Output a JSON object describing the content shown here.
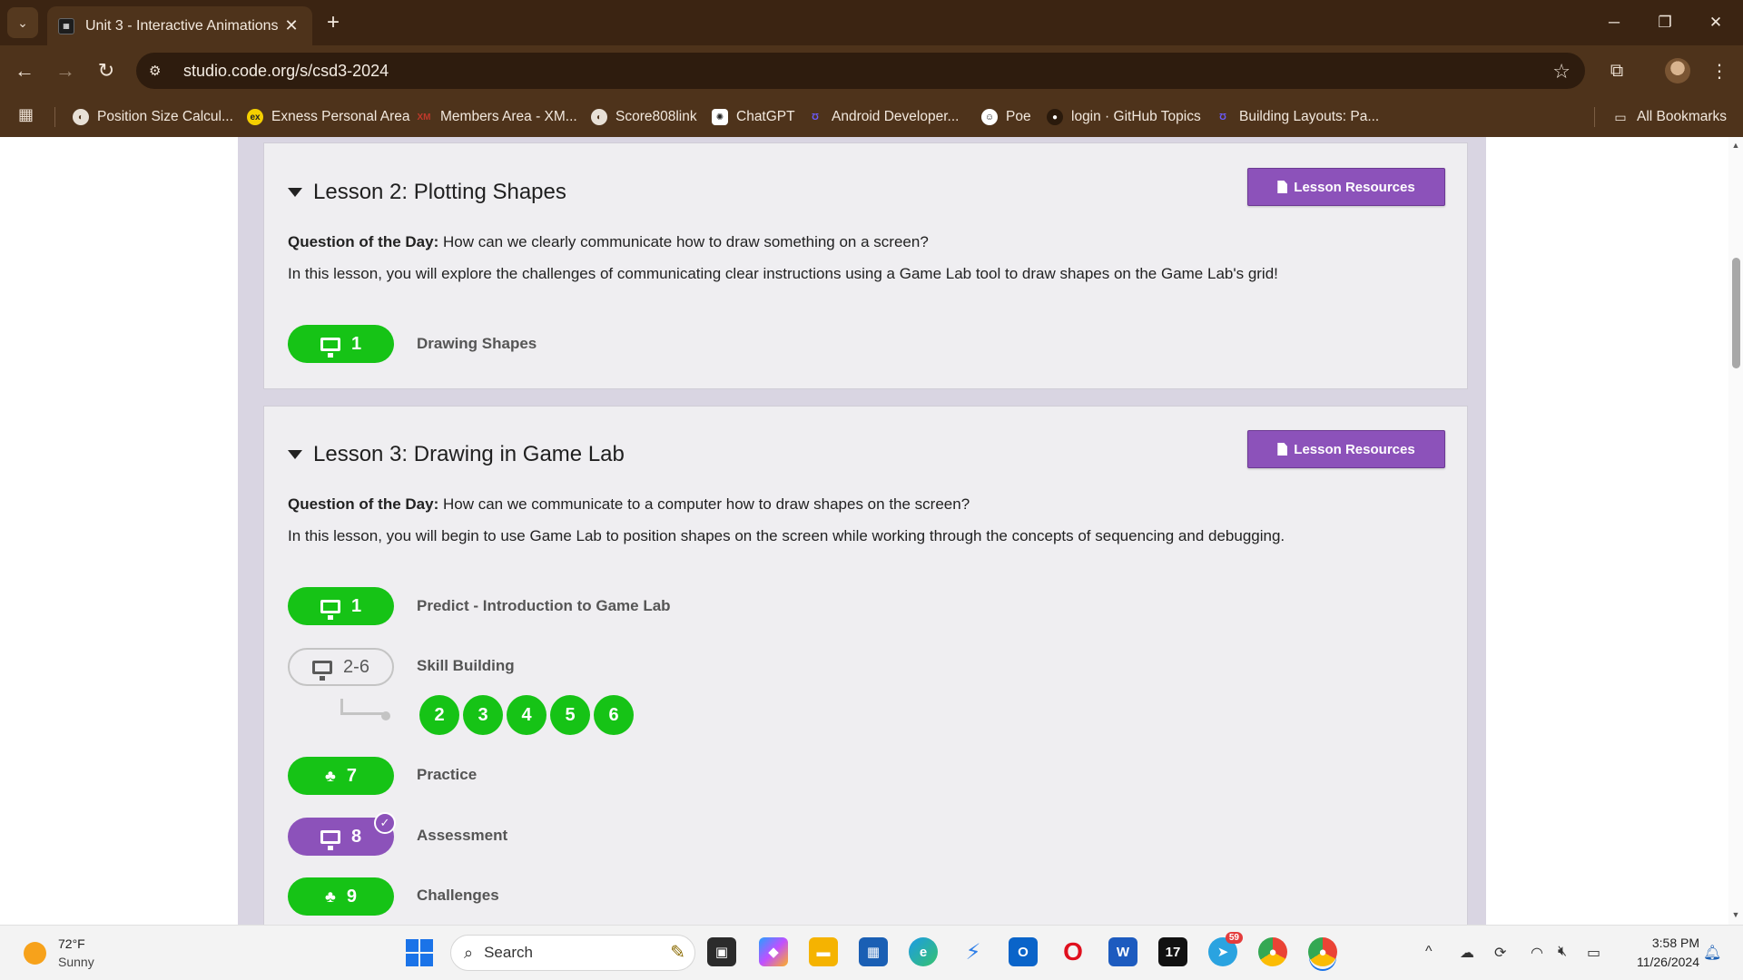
{
  "browser": {
    "tab_title": "Unit 3 - Interactive Animations",
    "tab_close": "✕",
    "new_tab": "+",
    "url": "studio.code.org/s/csd3-2024",
    "bookmarks": [
      {
        "label": "Position Size Calcul...",
        "icon": "globe-icon"
      },
      {
        "label": "Exness Personal Area",
        "icon": "exness-icon"
      },
      {
        "label": "Members Area - XM...",
        "icon": "xm-icon"
      },
      {
        "label": "Score808link",
        "icon": "globe-icon"
      },
      {
        "label": "ChatGPT",
        "icon": "chatgpt-icon"
      },
      {
        "label": "Android Developer...",
        "icon": "udemy-icon"
      },
      {
        "label": "Poe",
        "icon": "poe-icon"
      },
      {
        "label": "login · GitHub Topics",
        "icon": "github-icon"
      },
      {
        "label": "Building Layouts: Pa...",
        "icon": "udemy-icon"
      }
    ],
    "all_bookmarks": "All Bookmarks"
  },
  "lessons": [
    {
      "title": "Lesson 2: Plotting Shapes",
      "resources_label": "Lesson Resources",
      "qotd_label": "Question of the Day:",
      "qotd_text": " How can we clearly communicate how to draw something on a screen?",
      "description": "In this lesson, you will explore the challenges of communicating clear instructions using a Game Lab tool to draw shapes on the Game Lab's grid!",
      "levels": [
        {
          "number": "1",
          "label": "Drawing Shapes",
          "status": "completed",
          "icon": "monitor-icon"
        }
      ]
    },
    {
      "title": "Lesson 3: Drawing in Game Lab",
      "resources_label": "Lesson Resources",
      "qotd_label": "Question of the Day:",
      "qotd_text": " How can we communicate to a computer how to draw shapes on the screen?",
      "description": "In this lesson, you will begin to use Game Lab to position shapes on the screen while working through the concepts of sequencing and debugging.",
      "levels": [
        {
          "number": "1",
          "label": "Predict - Introduction to Game Lab",
          "status": "completed",
          "icon": "monitor-icon"
        },
        {
          "number": "2-6",
          "label": "Skill Building",
          "status": "group",
          "icon": "monitor-icon",
          "sublevels": [
            "2",
            "3",
            "4",
            "5",
            "6"
          ]
        },
        {
          "number": "7",
          "label": "Practice",
          "status": "completed",
          "icon": "hierarchy-icon"
        },
        {
          "number": "8",
          "label": "Assessment",
          "status": "assessment-submitted",
          "icon": "monitor-icon"
        },
        {
          "number": "9",
          "label": "Challenges",
          "status": "completed",
          "icon": "hierarchy-icon"
        }
      ]
    }
  ],
  "colors": {
    "completed": "#16c316",
    "assessment": "#8c52ba",
    "resources_button": "#8c52ba",
    "browser_frame": "#4e331b"
  },
  "taskbar": {
    "weather_temp": "72°F",
    "weather_condition": "Sunny",
    "search_placeholder": "Search",
    "telegram_badge": "59",
    "time": "3:58 PM",
    "date": "11/26/2024"
  }
}
